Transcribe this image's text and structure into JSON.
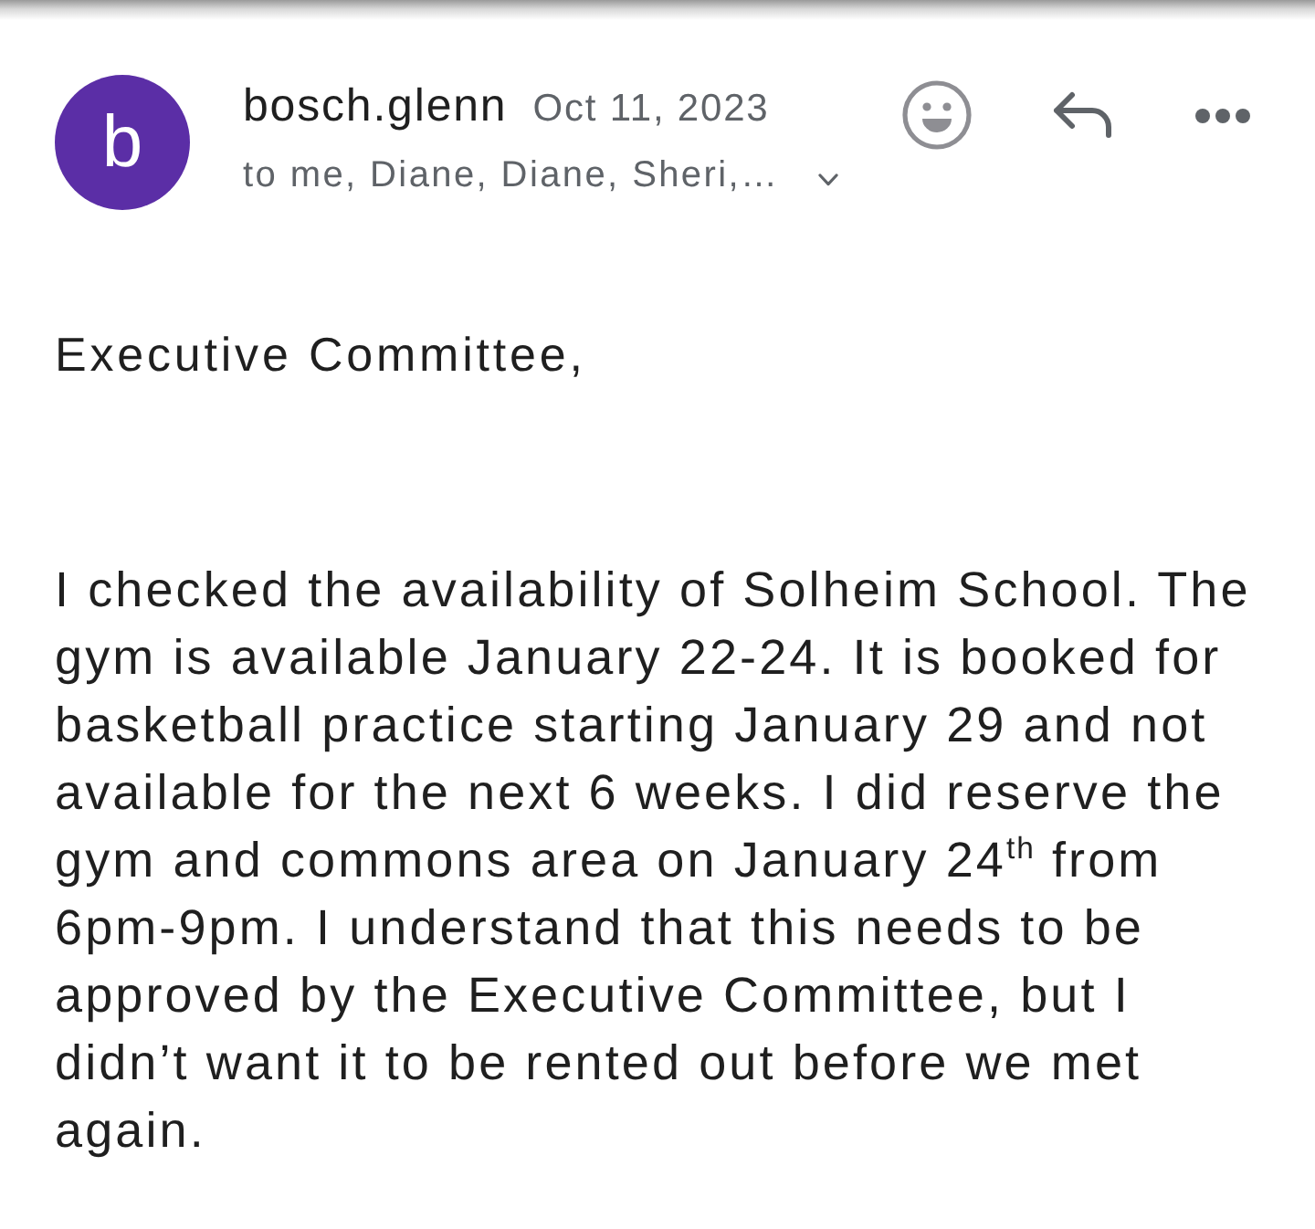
{
  "message": {
    "header": {
      "avatar_letter": "b",
      "sender": "bosch.glenn",
      "date": "Oct 11, 2023",
      "recipients": "to me, Diane, Diane, Sheri,…"
    },
    "greeting": "Executive Committee,",
    "body": "I checked the availability of Solheim School. The gym is available January 22-24. It is booked for basketball practice starting January 29 and not available for the next 6 weeks. I did reserve the gym and commons area on January 24$^{th}$ from 6pm-9pm. I understand that this needs to be approved by the Executive Committee, but I didn’t want it to be rented out before we met again."
  }
}
